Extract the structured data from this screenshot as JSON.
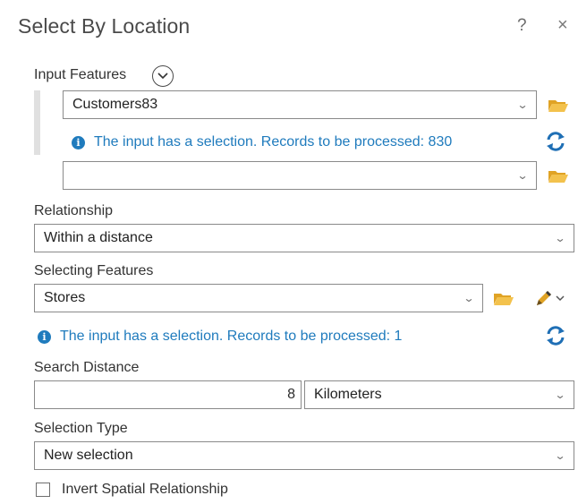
{
  "title": "Select By Location",
  "title_help": "?",
  "title_close": "×",
  "input_features": {
    "label": "Input Features",
    "items": [
      {
        "value": "Customers83"
      },
      {
        "value": ""
      }
    ],
    "info": "The input has a selection. Records to be processed: 830"
  },
  "relationship": {
    "label": "Relationship",
    "value": "Within a distance"
  },
  "selecting_features": {
    "label": "Selecting Features",
    "value": "Stores",
    "info": "The input has a selection. Records to be processed: 1"
  },
  "search_distance": {
    "label": "Search Distance",
    "value": "8",
    "unit": "Kilometers"
  },
  "selection_type": {
    "label": "Selection Type",
    "value": "New selection"
  },
  "invert": {
    "label": "Invert Spatial Relationship",
    "checked": false
  },
  "icons": {
    "folder_color": "#f0b93b",
    "refresh_color": "#1f6fb5",
    "info_color": "#1f7bbd"
  }
}
